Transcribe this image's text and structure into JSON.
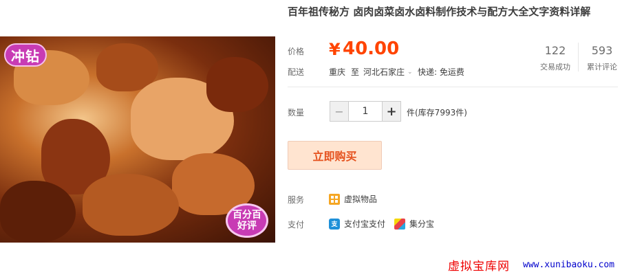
{
  "product": {
    "title": "百年祖传秘方 卤肉卤菜卤水卤料制作技术与配方大全文字资料详解",
    "image_badges": {
      "top_left": "冲钻",
      "bottom_right_line1": "百分百",
      "bottom_right_line2": "好评"
    }
  },
  "price": {
    "label": "价格",
    "currency": "¥",
    "value": "40.00"
  },
  "stats": {
    "sales": {
      "value": "122",
      "label": "交易成功"
    },
    "reviews": {
      "value": "593",
      "label": "累计评论"
    }
  },
  "shipping": {
    "label": "配送",
    "from": "重庆",
    "to_word": "至",
    "to": "河北石家庄",
    "method": "快递: 免运费"
  },
  "quantity": {
    "label": "数量",
    "minus": "−",
    "value": "1",
    "plus": "+",
    "stock": "件(库存7993件)"
  },
  "buy_button": "立即购买",
  "service": {
    "label": "服务",
    "items": [
      {
        "icon": "virtual-goods-icon",
        "text": "虚拟物品"
      }
    ]
  },
  "payment": {
    "label": "支付",
    "methods": [
      {
        "icon": "alipay-icon",
        "text": "支付宝支付"
      },
      {
        "icon": "jifenbao-icon",
        "text": "集分宝"
      }
    ]
  },
  "watermark": {
    "site": "虚拟宝库网",
    "url": "www.xunibaoku.com"
  },
  "colors": {
    "price": "#ff4400",
    "buy_bg": "#ffe4d0",
    "buy_text": "#e5511d",
    "badge": "#c83bb4"
  }
}
